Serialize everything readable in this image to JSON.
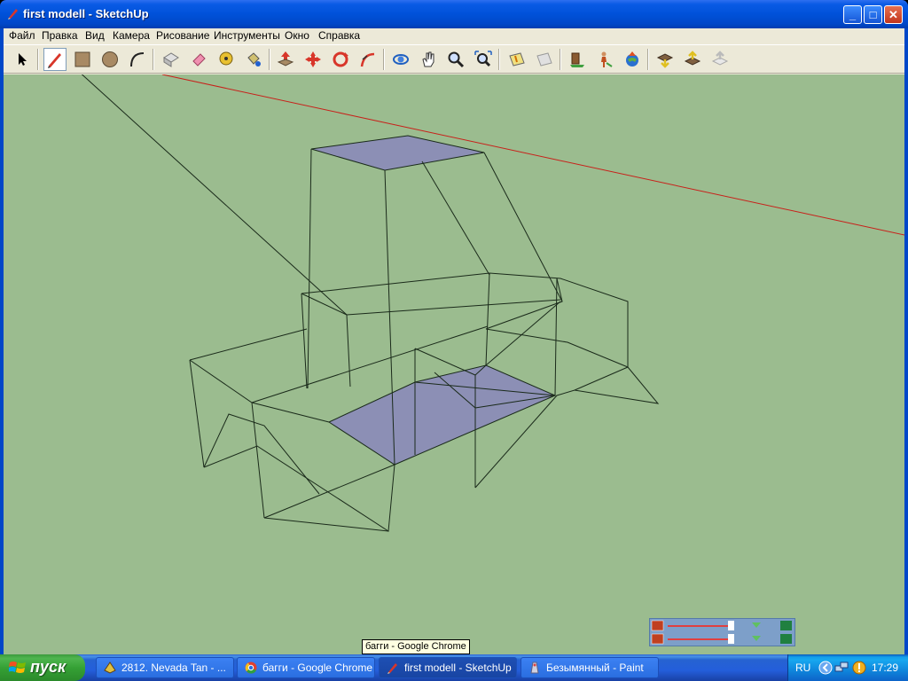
{
  "window": {
    "title": "first modell - SketchUp",
    "minimize_label": "_",
    "maximize_label": "□",
    "close_label": "✕"
  },
  "menu": {
    "items": [
      "Файл",
      "Правка",
      "Вид",
      "Камера",
      "Рисование",
      "Инструменты",
      "Окно",
      "Справка"
    ]
  },
  "toolbar": {
    "tools": [
      "select-icon",
      "pencil-icon",
      "rectangle-icon",
      "circle-icon",
      "arc-icon",
      "make-component-icon",
      "eraser-icon",
      "tape-measure-icon",
      "paint-bucket-icon",
      "push-pull-icon",
      "move-icon",
      "rotate-icon",
      "follow-me-icon",
      "orbit-icon",
      "pan-icon",
      "zoom-icon",
      "zoom-extents-icon",
      "section-plane-icon",
      "section-display-icon",
      "place-model-icon",
      "person-icon",
      "google-earth-icon",
      "get-models-icon",
      "share-model-icon",
      "upload-icon"
    ]
  },
  "tooltip": {
    "text": "багги - Google Chrome"
  },
  "taskbar": {
    "start_label": "пуск",
    "tasks": [
      {
        "label": "2812. Nevada Tan - ...",
        "active": false
      },
      {
        "label": "багги - Google Chrome",
        "active": false
      },
      {
        "label": "first modell - SketchUp",
        "active": true
      },
      {
        "label": "Безымянный - Paint",
        "active": false
      }
    ],
    "language": "RU",
    "clock": "17:29"
  },
  "colors": {
    "viewport_bg": "#9bbc8f",
    "face": "#8c8fb5",
    "edge": "#1a2a1a",
    "red_axis": "#c8201a"
  }
}
